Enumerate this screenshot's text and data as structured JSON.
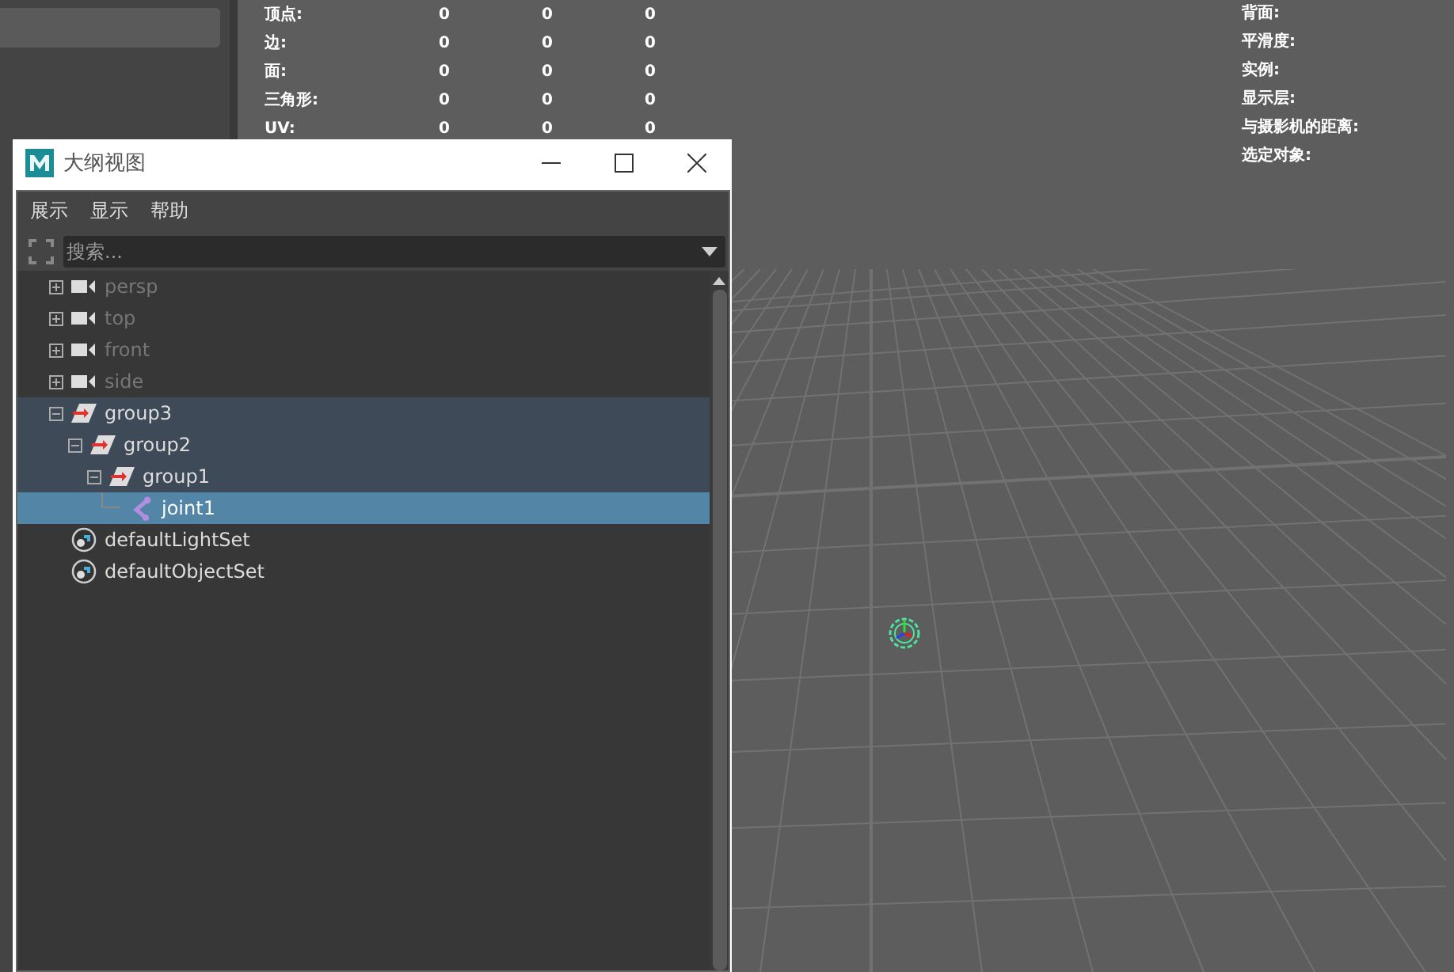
{
  "stats_left": [
    {
      "label": "顶点:",
      "values": [
        "0",
        "0",
        "0"
      ]
    },
    {
      "label": "边:",
      "values": [
        "0",
        "0",
        "0"
      ]
    },
    {
      "label": "面:",
      "values": [
        "0",
        "0",
        "0"
      ]
    },
    {
      "label": "三角形:",
      "values": [
        "0",
        "0",
        "0"
      ]
    },
    {
      "label": "UV:",
      "values": [
        "0",
        "0",
        "0"
      ]
    }
  ],
  "stats_right": [
    "背面:",
    "平滑度:",
    "实例:",
    "显示层:",
    "与摄影机的距离:",
    "选定对象:"
  ],
  "outliner": {
    "title": "大纲视图",
    "menu": [
      "展示",
      "显示",
      "帮助"
    ],
    "search": {
      "placeholder": "搜索..."
    },
    "items": [
      {
        "name": "persp",
        "kind": "camera",
        "dimmed": true,
        "expanded": false,
        "selected": false,
        "highlighted": false
      },
      {
        "name": "top",
        "kind": "camera",
        "dimmed": true,
        "expanded": false,
        "selected": false,
        "highlighted": false
      },
      {
        "name": "front",
        "kind": "camera",
        "dimmed": true,
        "expanded": false,
        "selected": false,
        "highlighted": false
      },
      {
        "name": "side",
        "kind": "camera",
        "dimmed": true,
        "expanded": false,
        "selected": false,
        "highlighted": false
      },
      {
        "name": "group3",
        "kind": "transform",
        "dimmed": false,
        "expanded": true,
        "selected": false,
        "highlighted": true,
        "children": [
          {
            "name": "group2",
            "kind": "transform",
            "dimmed": false,
            "expanded": true,
            "selected": false,
            "highlighted": true,
            "children": [
              {
                "name": "group1",
                "kind": "transform",
                "dimmed": false,
                "expanded": true,
                "selected": false,
                "highlighted": true,
                "children": [
                  {
                    "name": "joint1",
                    "kind": "joint",
                    "dimmed": false,
                    "selected": true,
                    "highlighted": false
                  }
                ]
              }
            ]
          }
        ]
      },
      {
        "name": "defaultLightSet",
        "kind": "set",
        "dimmed": false,
        "selected": false,
        "highlighted": false
      },
      {
        "name": "defaultObjectSet",
        "kind": "set",
        "dimmed": false,
        "selected": false,
        "highlighted": false
      }
    ]
  }
}
